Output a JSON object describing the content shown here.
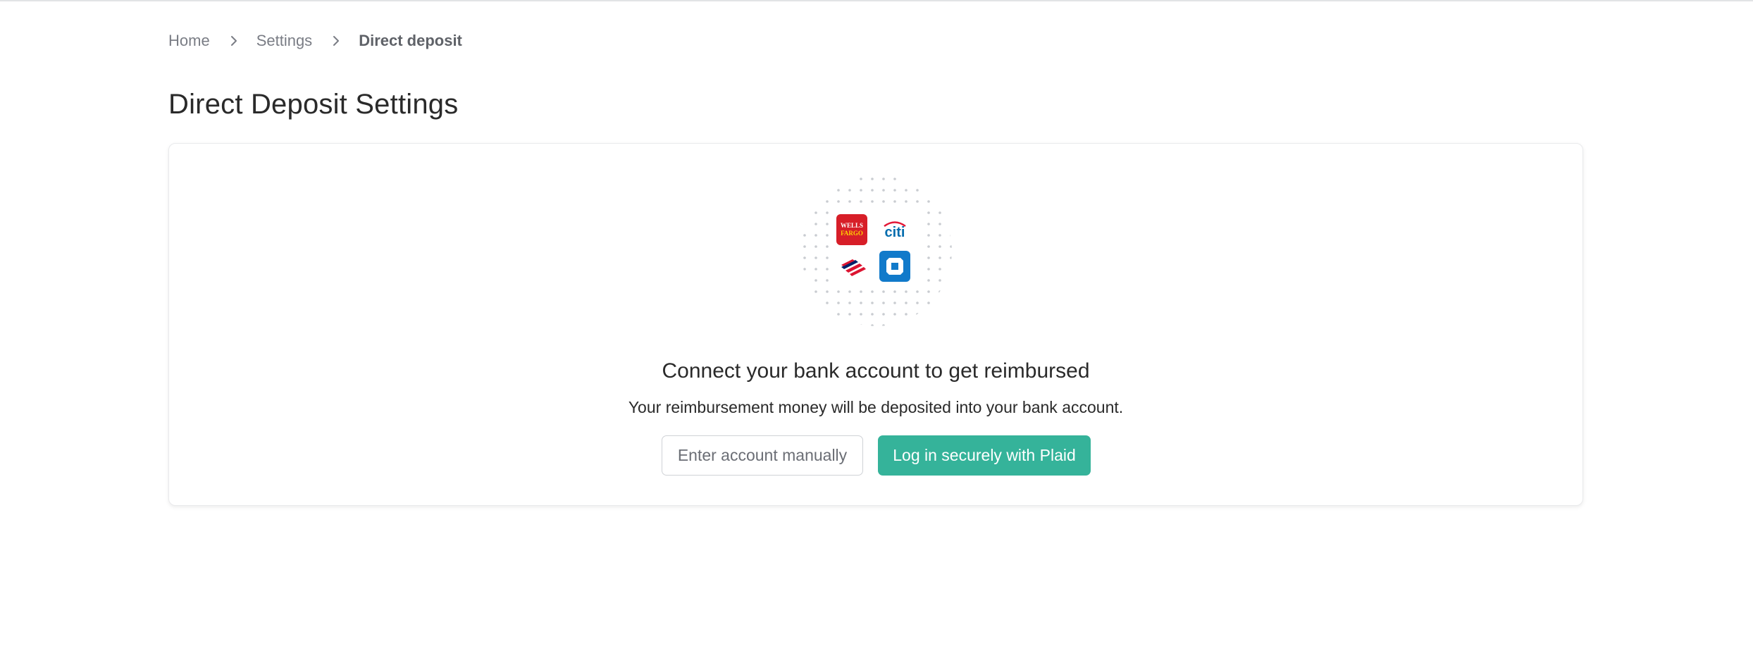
{
  "breadcrumb": {
    "items": [
      "Home",
      "Settings",
      "Direct deposit"
    ],
    "separator_icon": "chevron-right-icon"
  },
  "page": {
    "title": "Direct Deposit Settings"
  },
  "card": {
    "illustration": {
      "logos": [
        {
          "name": "wells-fargo-logo",
          "text": "WELLS FARGO",
          "color": "#d71e28"
        },
        {
          "name": "citi-logo",
          "text": "citi",
          "color": "#056dae"
        },
        {
          "name": "bank-of-america-logo",
          "color": "#dc1431"
        },
        {
          "name": "chase-logo",
          "color": "#117aca"
        }
      ]
    },
    "title": "Connect your bank account to get reimbursed",
    "subtitle": "Your reimbursement money will be deposited into your bank account.",
    "buttons": {
      "manual": "Enter account manually",
      "plaid": "Log in securely with Plaid"
    }
  },
  "colors": {
    "accent": "#35b39a",
    "text": "#2a2a2a",
    "muted": "#7a7d85",
    "border": "#e9eaec"
  }
}
